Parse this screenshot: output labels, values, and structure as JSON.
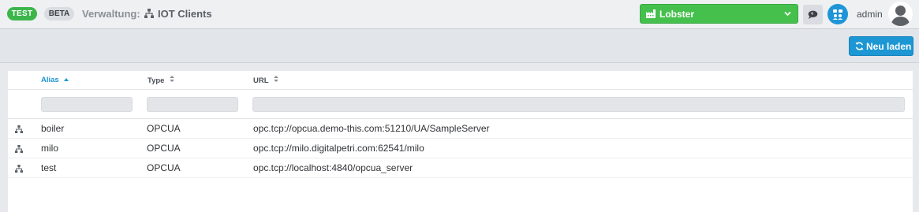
{
  "header": {
    "badge_test": "TEST",
    "badge_beta": "BETA",
    "section_label": "Verwaltung:",
    "page_title": "IOT Clients",
    "tenant_selected": "Lobster",
    "username": "admin"
  },
  "toolbar": {
    "reload_label": "Neu laden"
  },
  "table": {
    "columns": [
      {
        "label": "Alias",
        "sort": "asc"
      },
      {
        "label": "Type",
        "sort": "none"
      },
      {
        "label": "URL",
        "sort": "none"
      }
    ],
    "rows": [
      {
        "alias": "boiler",
        "type": "OPCUA",
        "url": "opc.tcp://opcua.demo-this.com:51210/UA/SampleServer"
      },
      {
        "alias": "milo",
        "type": "OPCUA",
        "url": "opc.tcp://milo.digitalpetri.com:62541/milo"
      },
      {
        "alias": "test",
        "type": "OPCUA",
        "url": "opc.tcp://localhost:4840/opcua_server"
      }
    ]
  },
  "colors": {
    "success": "#3cb64b",
    "primary": "#1c97d4",
    "tenant": "#46c04d"
  },
  "icons": {
    "breadcrumb": "sitemap-icon",
    "tenant": "factory-icon",
    "chat": "chat-icon",
    "org": "group-icon",
    "reload": "refresh-icon",
    "row": "sitemap-icon"
  }
}
